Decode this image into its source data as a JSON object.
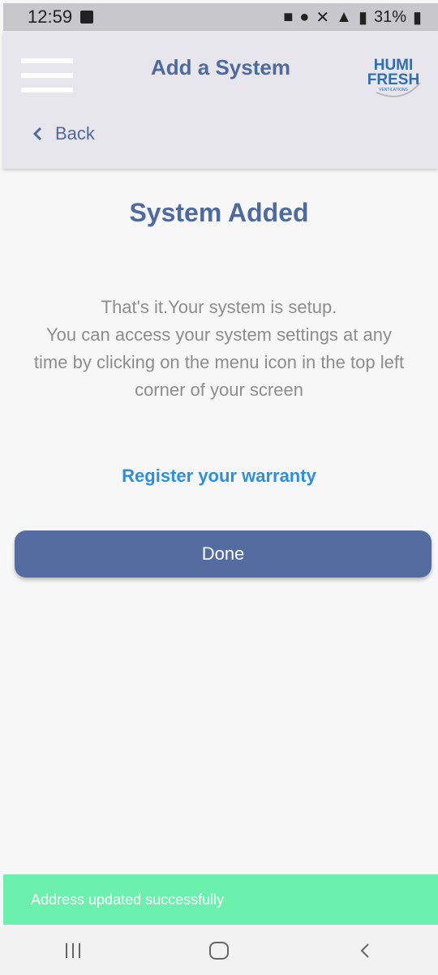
{
  "status_bar": {
    "time": "12:59",
    "battery": "31%"
  },
  "header": {
    "title": "Add a System",
    "back_label": "Back",
    "logo": {
      "line1": "HUMI",
      "line2": "FRESH",
      "tagline": "VENTILATIONS"
    }
  },
  "main": {
    "title": "System Added",
    "message_lines": [
      "That's it.Your system is setup.",
      "You can access your system settings at any",
      "time by clicking on the menu icon in the top left",
      "corner of your screen"
    ],
    "warranty_link": "Register your warranty",
    "done_label": "Done"
  },
  "toast": {
    "text": "Address updated successfully"
  },
  "colors": {
    "accent": "#4f6a9c",
    "button": "#556ca0",
    "link": "#2f8fd8",
    "toast": "#6cf0ad"
  }
}
